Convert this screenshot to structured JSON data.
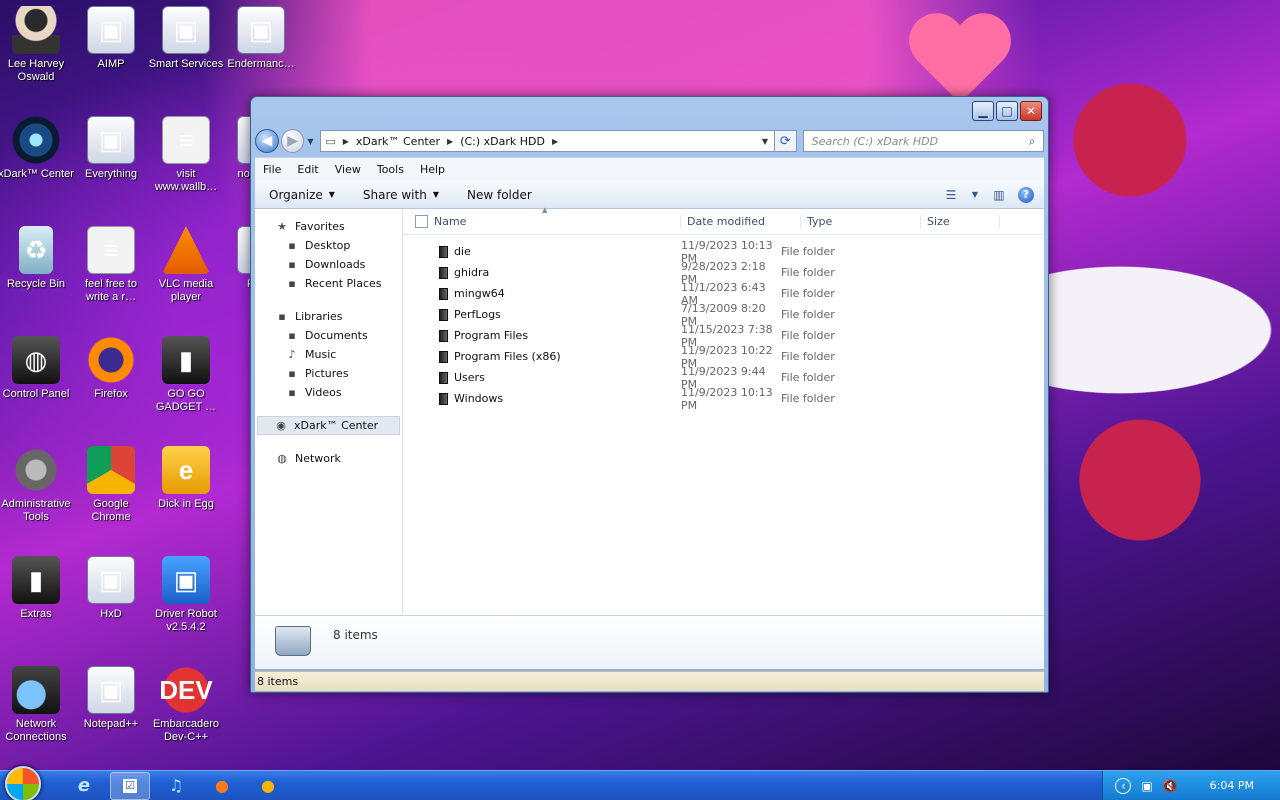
{
  "desktop": {
    "icons": [
      {
        "label": "Lee Harvey Oswald",
        "glyph": "☺"
      },
      {
        "label": "AIMP",
        "glyph": "▣"
      },
      {
        "label": "Smart Services",
        "glyph": "▣"
      },
      {
        "label": "Endermanc…",
        "glyph": "▣"
      },
      {
        "label": "xDark™ Center",
        "glyph": "◉"
      },
      {
        "label": "Everything",
        "glyph": "▣"
      },
      {
        "label": "visit www.wallb…",
        "glyph": "≡"
      },
      {
        "label": "non know",
        "glyph": "▣"
      },
      {
        "label": "Recycle Bin",
        "glyph": "♻"
      },
      {
        "label": "feel free to write a r…",
        "glyph": "≡"
      },
      {
        "label": "VLC media player",
        "glyph": "▲"
      },
      {
        "label": "Pr Ha",
        "glyph": "▣"
      },
      {
        "label": "Control Panel",
        "glyph": "◍"
      },
      {
        "label": "Firefox",
        "glyph": "●"
      },
      {
        "label": "GO GO GADGET …",
        "glyph": "▮"
      },
      {
        "label": "Administrative Tools",
        "glyph": "⚙"
      },
      {
        "label": "Google Chrome",
        "glyph": "●"
      },
      {
        "label": "Dick in Egg",
        "glyph": "e"
      },
      {
        "label": "Extras",
        "glyph": "▮"
      },
      {
        "label": "HxD",
        "glyph": "▣"
      },
      {
        "label": "Driver Robot v2.5.4.2",
        "glyph": "▣"
      },
      {
        "label": "Network Connections",
        "glyph": "◍"
      },
      {
        "label": "Notepad++",
        "glyph": "▣"
      },
      {
        "label": "Embarcadero Dev-C++",
        "glyph": "DEV"
      }
    ]
  },
  "window": {
    "controls": {
      "minimize": "▁",
      "maximize": "□",
      "close": "✕"
    },
    "nav": {
      "back": "◀",
      "forward": "▶",
      "dropdown": "▼"
    },
    "address": {
      "root_icon": "▭",
      "crumb1": "xDark™ Center",
      "crumb2": "(C:) xDark HDD",
      "sep": "▶",
      "dd": "▼",
      "refresh": "⟳"
    },
    "search": {
      "placeholder": "Search (C:) xDark HDD",
      "icon": "⌕"
    },
    "menu": [
      "File",
      "Edit",
      "View",
      "Tools",
      "Help"
    ],
    "commands": {
      "organize": "Organize",
      "share": "Share with",
      "new_folder": "New folder",
      "caret": "▼",
      "views_icon": "☰",
      "pane_icon": "▥",
      "help_icon": "?"
    },
    "navpane": {
      "favorites": {
        "label": "Favorites",
        "icon": "★",
        "items": [
          {
            "label": "Desktop",
            "icon": "▪"
          },
          {
            "label": "Downloads",
            "icon": "▪"
          },
          {
            "label": "Recent Places",
            "icon": "▪"
          }
        ]
      },
      "libraries": {
        "label": "Libraries",
        "icon": "▪",
        "items": [
          {
            "label": "Documents",
            "icon": "▪"
          },
          {
            "label": "Music",
            "icon": "♪"
          },
          {
            "label": "Pictures",
            "icon": "▪"
          },
          {
            "label": "Videos",
            "icon": "▪"
          }
        ]
      },
      "computer": {
        "label": "xDark™ Center",
        "icon": "◉"
      },
      "network": {
        "label": "Network",
        "icon": "◍"
      }
    },
    "columns": {
      "name": "Name",
      "date": "Date modified",
      "type": "Type",
      "size": "Size",
      "sort": "▲"
    },
    "files": [
      {
        "name": "die",
        "date": "11/9/2023 10:13 PM",
        "type": "File folder"
      },
      {
        "name": "ghidra",
        "date": "9/28/2023 2:18 PM",
        "type": "File folder"
      },
      {
        "name": "mingw64",
        "date": "11/1/2023 6:43 AM",
        "type": "File folder"
      },
      {
        "name": "PerfLogs",
        "date": "7/13/2009 8:20 PM",
        "type": "File folder"
      },
      {
        "name": "Program Files",
        "date": "11/15/2023 7:38 PM",
        "type": "File folder"
      },
      {
        "name": "Program Files (x86)",
        "date": "11/9/2023 10:22 PM",
        "type": "File folder"
      },
      {
        "name": "Users",
        "date": "11/9/2023 9:44 PM",
        "type": "File folder"
      },
      {
        "name": "Windows",
        "date": "11/9/2023 10:13 PM",
        "type": "File folder"
      }
    ],
    "details": {
      "count": "8 items"
    },
    "status": {
      "text": "8 items"
    }
  },
  "taskbar": {
    "items": [
      {
        "name": "internet-explorer",
        "glyph": "e"
      },
      {
        "name": "task-app",
        "glyph": "☑"
      },
      {
        "name": "music-player",
        "glyph": "♫"
      },
      {
        "name": "firefox",
        "glyph": "●"
      },
      {
        "name": "chrome",
        "glyph": "●"
      }
    ],
    "tray": {
      "chevron": "‹",
      "network": "▣",
      "volume": "🔇",
      "clock": "6:04 PM"
    }
  }
}
